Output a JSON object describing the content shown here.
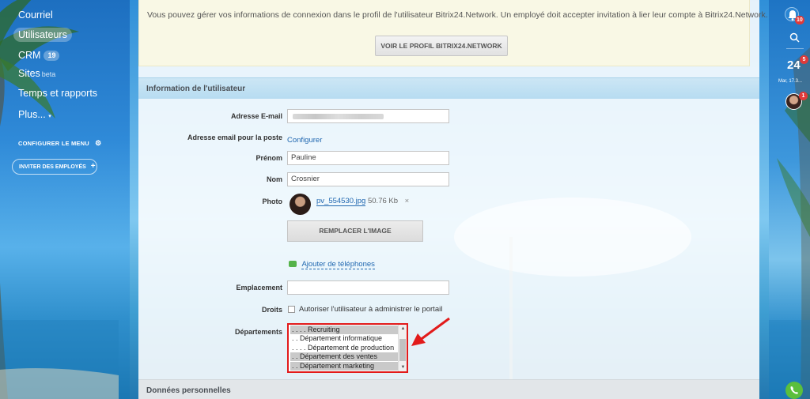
{
  "sidebar": {
    "items": [
      {
        "label": "Courriel"
      },
      {
        "label": "Utilisateurs"
      },
      {
        "label": "CRM",
        "badge": "19"
      },
      {
        "label": "Sites",
        "tag": "beta"
      },
      {
        "label": "Temps et rapports"
      },
      {
        "label": "Plus...",
        "suffix": "▾"
      }
    ],
    "configure_menu": "CONFIGURER LE MENU",
    "invite_employees": "INVITER DES EMPLOYÉS"
  },
  "notice": {
    "text": "Vous pouvez gérer vos informations de connexion dans le profil de l'utilisateur Bitrix24.Network. Un employé doit accepter invitation à lier leur compte à Bitrix24.Network.",
    "button": "VOIR LE PROFIL BITRIX24.NETWORK"
  },
  "form": {
    "section_title": "Information de l'utilisateur",
    "email_label": "Adresse E-mail",
    "mail_label": "Adresse email pour la poste",
    "mail_link": "Configurer",
    "firstname_label": "Prénom",
    "firstname_value": "Pauline",
    "lastname_label": "Nom",
    "lastname_value": "Crosnier",
    "photo_label": "Photo",
    "photo_file": "pv_554530.jpg",
    "photo_size": "50.76 Kb",
    "photo_remove": "×",
    "replace_button": "REMPLACER L'IMAGE",
    "add_phones": "Ajouter de téléphones",
    "location_label": "Emplacement",
    "rights_label": "Droits",
    "rights_checkbox": "Autoriser l'utilisateur à administrer le portail",
    "departments_label": "Départements",
    "departments": [
      {
        "label": ". . . . Recruiting",
        "selected": true
      },
      {
        "label": ". . Département informatique",
        "selected": false
      },
      {
        "label": ". . . . Département de production",
        "selected": false
      },
      {
        "label": ". . Département des ventes",
        "selected": true
      },
      {
        "label": ". . Département marketing",
        "selected": true
      }
    ],
    "personal_section_title": "Données personnelles"
  },
  "rail": {
    "notifications_badge": "10",
    "calendar_number": "24",
    "calendar_badge": "5",
    "date_text": "Mar, 17.3...",
    "avatar_badge": "1"
  },
  "colors": {
    "accent_link": "#2067b0",
    "highlight_border": "#e21b1b",
    "badge_red": "#e03a3a",
    "call_green": "#5bbf3c"
  }
}
